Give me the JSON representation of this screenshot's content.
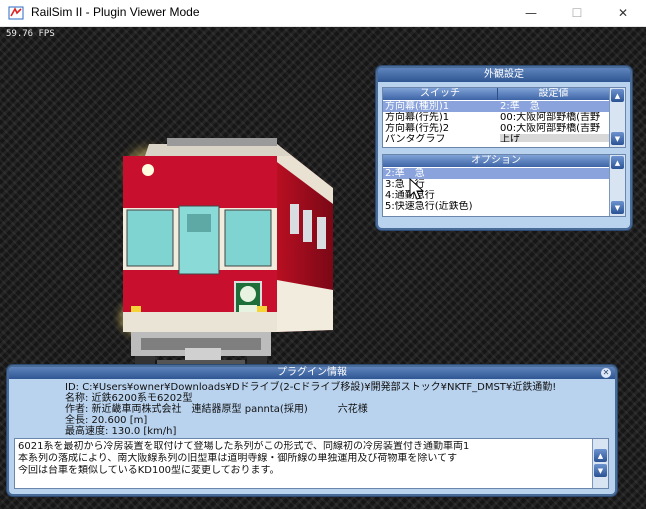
{
  "window": {
    "title": "RailSim II - Plugin Viewer Mode",
    "min_glyph": "—",
    "max_glyph": "☐",
    "close_glyph": "✕"
  },
  "viewport": {
    "fps": "59.76 FPS"
  },
  "appearance_panel": {
    "title": "外観設定",
    "switch_header": "スイッチ",
    "value_header": "設定値",
    "switch_rows": [
      {
        "switch": "方向幕(種別)1",
        "value": "2:準　急",
        "selected": true
      },
      {
        "switch": "方向幕(行先)1",
        "value": "00:大阪阿部野橋(吉野",
        "selected": false
      },
      {
        "switch": "方向幕(行先)2",
        "value": "00:大阪阿部野橋(吉野",
        "selected": false
      },
      {
        "switch": "パンタグラフ",
        "value": "上げ",
        "selected": false
      }
    ],
    "option_header": "オプション",
    "option_rows": [
      {
        "label": "2:準　急",
        "selected": true
      },
      {
        "label": "3:急　行",
        "selected": false
      },
      {
        "label": "4:通勤急行",
        "selected": false
      },
      {
        "label": "5:快速急行(近鉄色)",
        "selected": false
      }
    ]
  },
  "plugin_info": {
    "title": "プラグイン情報",
    "close_glyph": "✕",
    "id_line": "ID: C:¥Users¥owner¥Downloads¥Dドライブ(2-Cドライブ移設)¥開発部ストック¥NKTF_DMST¥近鉄通勤!",
    "name_line": "名称: 近鉄6200系モ6202型",
    "author_line": "作者: 新近畿車両株式会社　連結器原型 pannta(採用)　　　六花様",
    "length_line": "全長: 20.600 [m]",
    "speed_line": "最高速度: 130.0 [km/h]",
    "description": [
      "6021系を最初から冷房装置を取付けて登場した系列がこの形式で、同線初の冷房装置付き通勤車両1",
      "本系列の落成により、南大阪線系列の旧型車は道明寺線・御所線の単独運用及び荷物車を除いてす",
      "今回は台車を類似しているKD100型に変更しております。"
    ]
  },
  "colors": {
    "panel_bg": "#b9d3ef",
    "panel_border": "#486b97",
    "selection": "#8aa3dc",
    "train_red": "#c8102e",
    "train_cream": "#f4efe3"
  }
}
